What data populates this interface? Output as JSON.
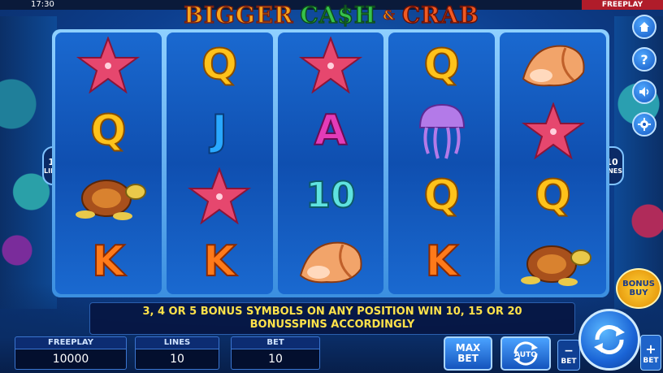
{
  "status_bar": {
    "time": "17:30",
    "mode": "FREEPLAY"
  },
  "logo": {
    "word1": "BIGGER",
    "word2": "CA$H",
    "word3": "&",
    "word4": "CRAB"
  },
  "paylines": {
    "count": "10",
    "label": "LINES"
  },
  "reels": [
    [
      "starfish",
      "Q",
      "turtle",
      "K"
    ],
    [
      "Q",
      "J",
      "starfish",
      "K"
    ],
    [
      "starfish",
      "A",
      "10",
      "shell"
    ],
    [
      "Q",
      "jellyfish",
      "Q",
      "K"
    ],
    [
      "shell",
      "starfish",
      "Q",
      "turtle"
    ]
  ],
  "info": {
    "line1": "3, 4 OR 5 BONUS SYMBOLS ON ANY POSITION WIN 10, 15 OR 20",
    "line2": "BONUSSPINS ACCORDINGLY"
  },
  "stats": {
    "freeplay_label": "FREEPLAY",
    "freeplay_value": "10000",
    "lines_label": "LINES",
    "lines_value": "10",
    "bet_label": "BET",
    "bet_value": "10"
  },
  "buttons": {
    "max_top": "MAX",
    "max_bottom": "BET",
    "auto": "AUTO",
    "bet_minus_sign": "−",
    "bet_minus_label": "BET",
    "bet_plus_sign": "+",
    "bet_plus_label": "BET",
    "bonus_top": "BONUS",
    "bonus_bottom": "BUY"
  },
  "side_icons": [
    "home-icon",
    "help-icon",
    "sound-icon",
    "settings-icon"
  ],
  "colors": {
    "accent": "#1a64d6",
    "info_text": "#ffe24a",
    "freeplay_tag": "#b01c2a"
  }
}
